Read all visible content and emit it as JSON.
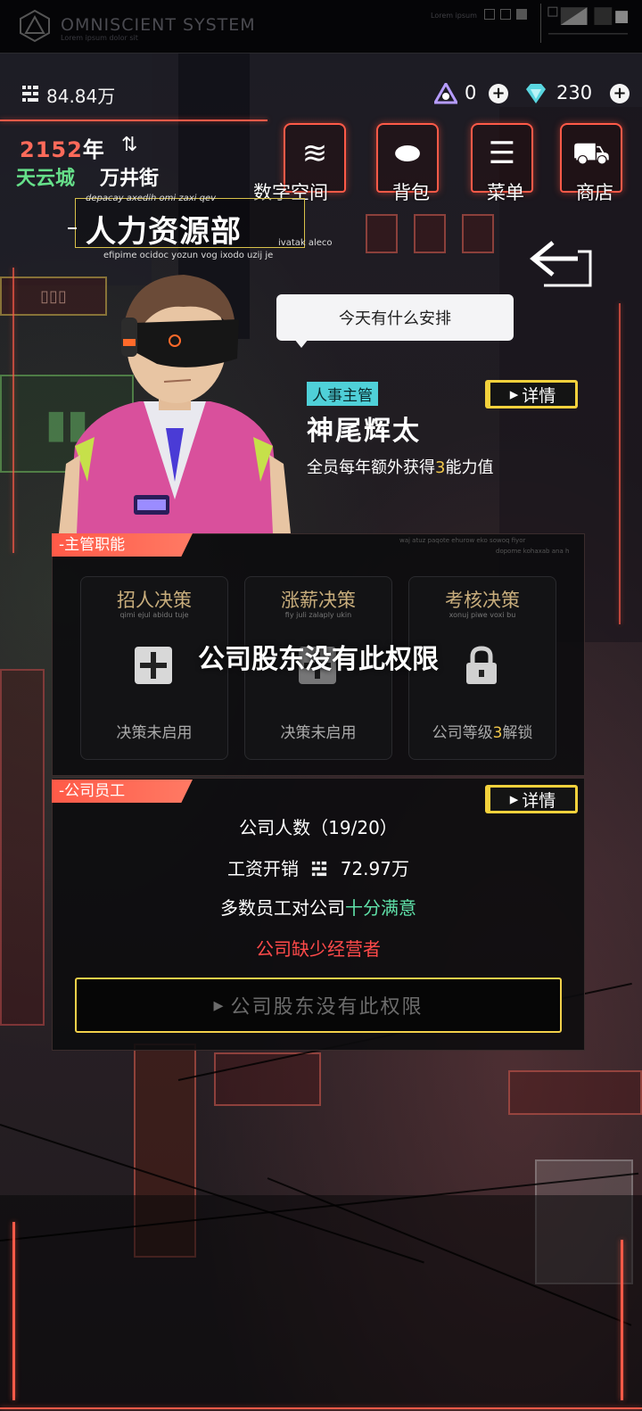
{
  "header": {
    "brand": "OMNISCIENT SYSTEM",
    "brand_sub": "Lorem ipsum dolor sit",
    "right_text": "Lorem ipsum"
  },
  "currency": {
    "money": "84.84万",
    "gem1": "0",
    "gem2": "230"
  },
  "location": {
    "year_number": "2152",
    "year_suffix": "年",
    "city": "天云城",
    "street": "万井街"
  },
  "nav": [
    {
      "label": "数字空间",
      "icon": "layers-icon"
    },
    {
      "label": "背包",
      "icon": "bag-icon"
    },
    {
      "label": "菜单",
      "icon": "list-icon"
    },
    {
      "label": "商店",
      "icon": "cart-icon"
    }
  ],
  "department": {
    "title": "人力资源部",
    "small_top": "depacay axedih omi zaxi qev",
    "small_side": "ivatak aleco",
    "small_bottom": "efipime ocidoc yozun vog ixodo uzij je"
  },
  "bubble": "今天有什么安排",
  "manager": {
    "role": "人事主管",
    "name": "神尾辉太",
    "perk_prefix": "全员每年额外获得",
    "perk_value": "3",
    "perk_suffix": "能力值",
    "detail_label": "详情"
  },
  "functions": {
    "section_label": "-主管职能",
    "tiny_text_1": "waj atuz paqote ehurow eko sowoq fiyor",
    "tiny_text_2": "dopome kohaxab ana h",
    "cards": [
      {
        "title": "招人决策",
        "sub": "qimi ejul abidu tuje",
        "status": "决策未启用",
        "icon": "plus-box-icon"
      },
      {
        "title": "涨薪决策",
        "sub": "fiy juli zalaply ukin",
        "status": "决策未启用",
        "icon": "plus-box-icon"
      },
      {
        "title": "考核决策",
        "sub": "xonuj piwe voxi bu",
        "status_prefix": "公司等级",
        "status_value": "3",
        "status_suffix": "解锁",
        "icon": "lock-icon"
      }
    ],
    "overlay_message": "公司股东没有此权限"
  },
  "staff": {
    "section_label": "-公司员工",
    "detail_label": "详情",
    "count_line": "公司人数（19/20）",
    "salary_label": "工资开销",
    "salary_value": "72.97万",
    "satisfaction_prefix": "多数员工对公司",
    "satisfaction_value": "十分满意",
    "warning": "公司缺少经营者",
    "action_label": "公司股东没有此权限"
  },
  "colors": {
    "accent": "#ff5a48",
    "gold": "#f4d13c",
    "green": "#66e08a",
    "teal": "#4fd0d8",
    "warning": "#ff4a4a"
  }
}
